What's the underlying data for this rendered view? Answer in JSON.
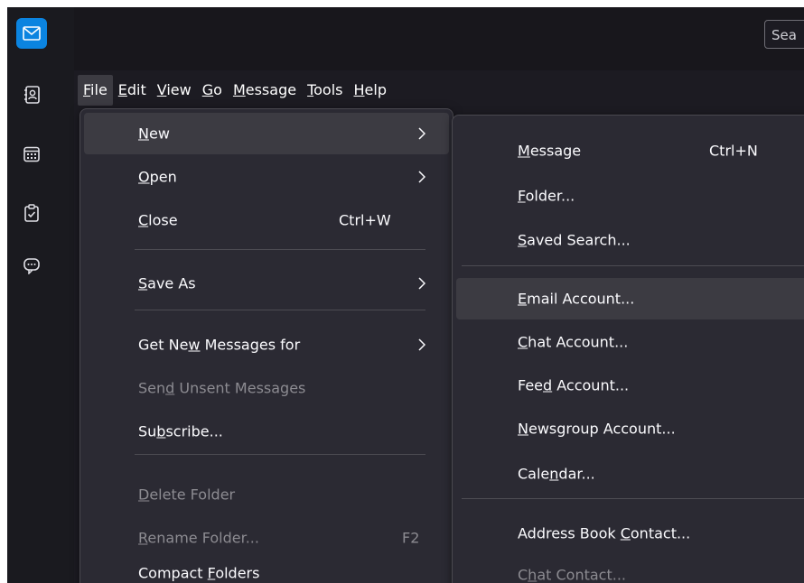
{
  "colors": {
    "accent": "#0b84e0",
    "background": "#1c1b22",
    "menu_background": "#2b2a33",
    "hover": "#3c3b42",
    "text": "#fbfbfe",
    "disabled_text": "#8c8b91"
  },
  "spaces_toolbar": [
    {
      "icon": "mail-icon",
      "active": true
    },
    {
      "icon": "address-book-icon",
      "active": false
    },
    {
      "icon": "calendar-icon",
      "active": false
    },
    {
      "icon": "tasks-icon",
      "active": false
    },
    {
      "icon": "chat-icon",
      "active": false
    }
  ],
  "search": {
    "text": "Sea"
  },
  "menubar": [
    {
      "pre": "",
      "acc": "F",
      "post": "ile"
    },
    {
      "pre": "",
      "acc": "E",
      "post": "dit"
    },
    {
      "pre": "",
      "acc": "V",
      "post": "iew"
    },
    {
      "pre": "",
      "acc": "G",
      "post": "o"
    },
    {
      "pre": "",
      "acc": "M",
      "post": "essage"
    },
    {
      "pre": "",
      "acc": "T",
      "post": "ools"
    },
    {
      "pre": "",
      "acc": "H",
      "post": "elp"
    }
  ],
  "file_menu": [
    {
      "pre": "",
      "acc": "N",
      "post": "ew",
      "shortcut": "",
      "arrow": true
    },
    {
      "pre": "",
      "acc": "O",
      "post": "pen",
      "shortcut": "",
      "arrow": true
    },
    {
      "pre": "",
      "acc": "C",
      "post": "lose",
      "shortcut": "Ctrl+W",
      "arrow": false
    },
    {
      "pre": "",
      "acc": "S",
      "post": "ave As",
      "shortcut": "",
      "arrow": true
    },
    {
      "pre": "Get Ne",
      "acc": "w",
      "post": " Messages for",
      "shortcut": "",
      "arrow": true
    },
    {
      "pre": "Sen",
      "acc": "d",
      "post": " Unsent Messages",
      "shortcut": "",
      "arrow": false
    },
    {
      "pre": "Su",
      "acc": "b",
      "post": "scribe...",
      "shortcut": "",
      "arrow": false
    },
    {
      "pre": "",
      "acc": "D",
      "post": "elete Folder",
      "shortcut": "",
      "arrow": false
    },
    {
      "pre": "",
      "acc": "R",
      "post": "ename Folder...",
      "shortcut": "F2",
      "arrow": false
    },
    {
      "pre": "Compact ",
      "acc": "F",
      "post": "olders",
      "shortcut": "",
      "arrow": false
    }
  ],
  "new_submenu": [
    {
      "pre": "",
      "acc": "M",
      "post": "essage",
      "shortcut": "Ctrl+N"
    },
    {
      "pre": "",
      "acc": "F",
      "post": "older...",
      "shortcut": ""
    },
    {
      "pre": "",
      "acc": "S",
      "post": "aved Search...",
      "shortcut": ""
    },
    {
      "pre": "",
      "acc": "E",
      "post": "mail Account...",
      "shortcut": ""
    },
    {
      "pre": "",
      "acc": "C",
      "post": "hat Account...",
      "shortcut": ""
    },
    {
      "pre": "Fee",
      "acc": "d",
      "post": " Account...",
      "shortcut": ""
    },
    {
      "pre": "",
      "acc": "N",
      "post": "ewsgroup Account...",
      "shortcut": ""
    },
    {
      "pre": "Cale",
      "acc": "n",
      "post": "dar...",
      "shortcut": ""
    },
    {
      "pre": "Address Book ",
      "acc": "C",
      "post": "ontact...",
      "shortcut": ""
    },
    {
      "pre": "C",
      "acc": "h",
      "post": "at Contact...",
      "shortcut": ""
    }
  ]
}
